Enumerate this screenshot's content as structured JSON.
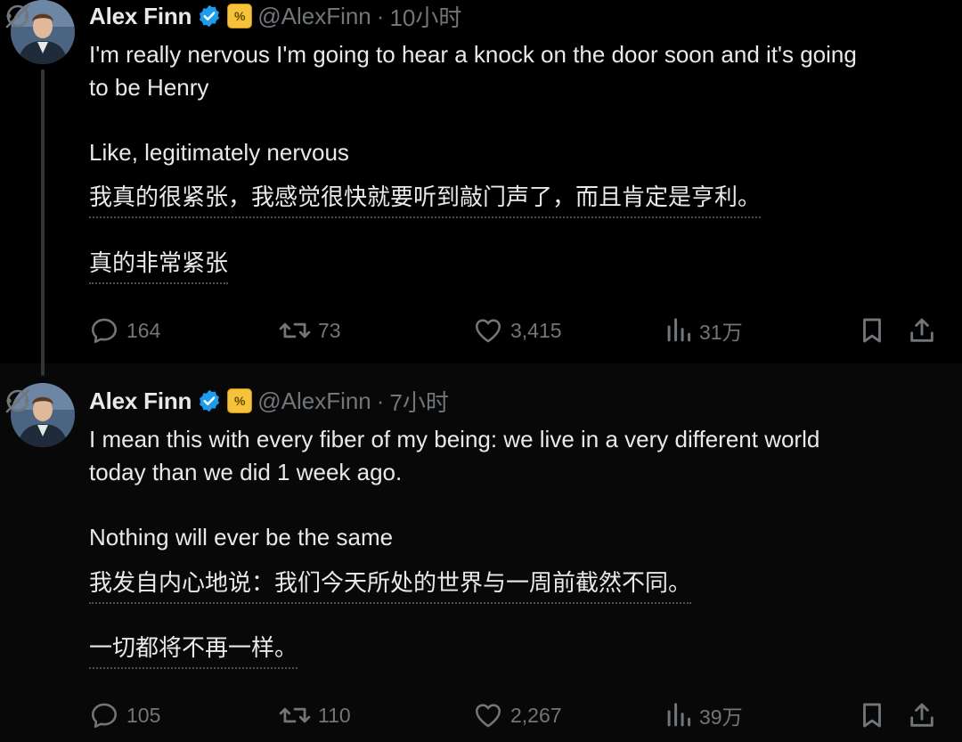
{
  "posts": [
    {
      "author": {
        "name": "Alex Finn",
        "handle": "@AlexFinn",
        "separator": "·",
        "time": "10小时",
        "affiliation_badge": "%"
      },
      "text": {
        "line1": "I'm really nervous I'm going to hear a knock on the door soon and it's going",
        "line2": "to be Henry",
        "line3": "Like, legitimately nervous"
      },
      "translation": {
        "line1": "我真的很紧张，我感觉很快就要听到敲门声了，而且肯定是亨利。",
        "line2": "真的非常紧张"
      },
      "stats": {
        "replies": "164",
        "reposts": "73",
        "likes": "3,415",
        "views": "31万"
      }
    },
    {
      "author": {
        "name": "Alex Finn",
        "handle": "@AlexFinn",
        "separator": "·",
        "time": "7小时",
        "affiliation_badge": "%"
      },
      "text": {
        "line1": "I mean this with every fiber of my being: we live in a very different world",
        "line2": "today than we did 1 week ago.",
        "line3": "Nothing will ever be the same"
      },
      "translation": {
        "line1": "我发自内心地说：我们今天所处的世界与一周前截然不同。",
        "line2": "一切都将不再一样。"
      },
      "stats": {
        "replies": "105",
        "reposts": "110",
        "likes": "2,267",
        "views": "39万"
      }
    }
  ],
  "icons": {
    "verified": "verified-badge-icon",
    "grok": "grok-icon",
    "more": "more-icon",
    "reply": "reply-icon",
    "repost": "repost-icon",
    "like": "heart-icon",
    "views": "views-icon",
    "bookmark": "bookmark-icon",
    "share": "share-icon"
  },
  "colors": {
    "background": "#000000",
    "text": "#e7e9ea",
    "muted": "#71767b",
    "verified": "#1d9bf0",
    "affiliation": "#f5c23b"
  }
}
